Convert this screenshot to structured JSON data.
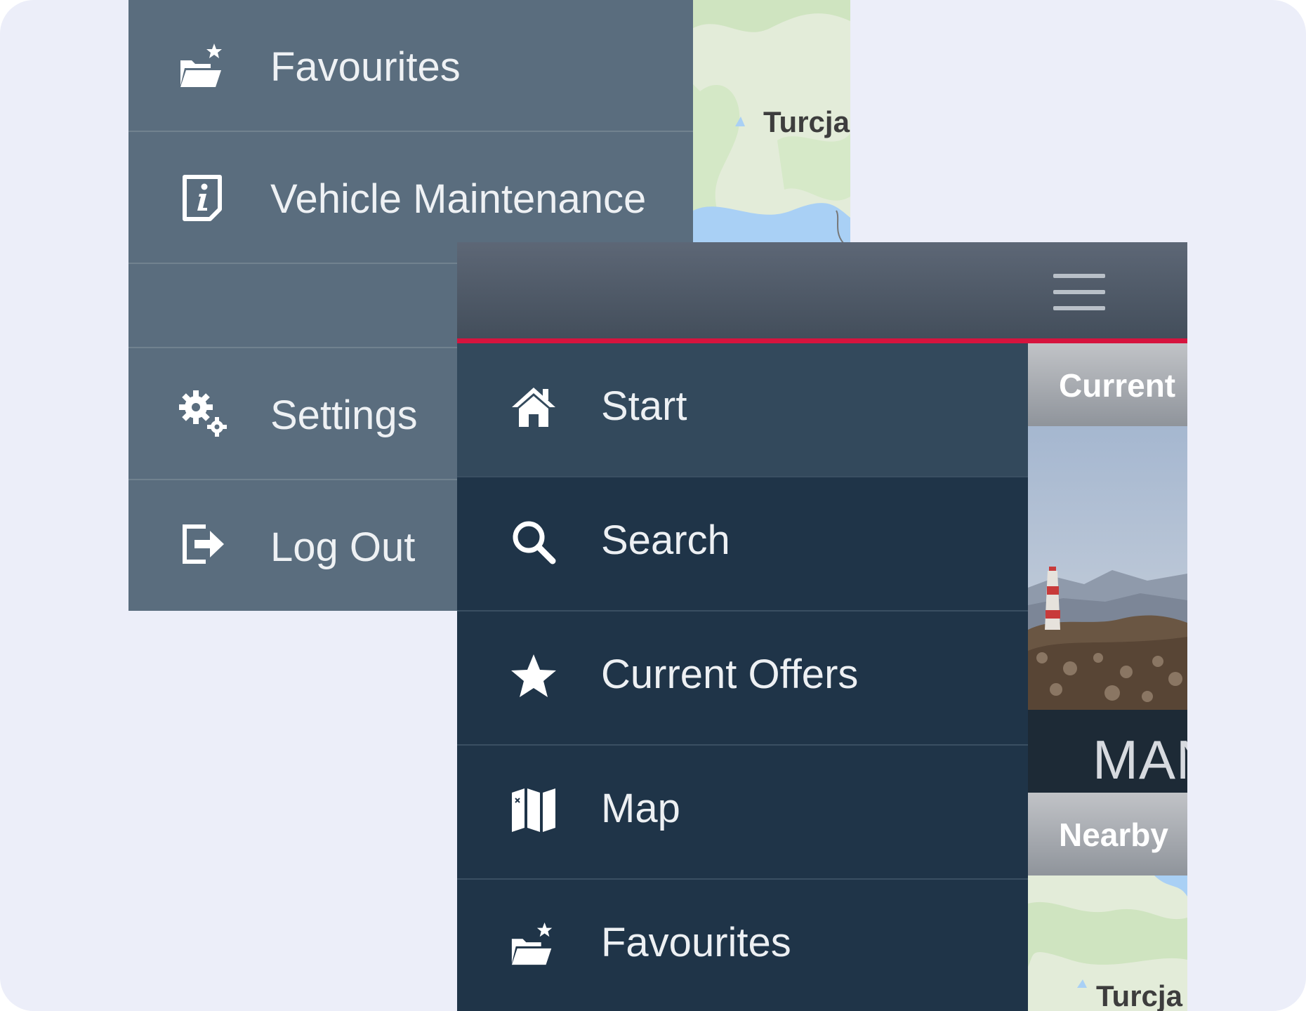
{
  "back_screen": {
    "menu": [
      {
        "label": "Favourites",
        "icon": "folder-star-icon"
      },
      {
        "label": "Vehicle  Maintenance",
        "icon": "info-document-icon"
      },
      {
        "label": "",
        "icon": ""
      },
      {
        "label": "Settings",
        "icon": "gears-icon"
      },
      {
        "label": "Log Out",
        "icon": "logout-icon"
      }
    ],
    "map_label": "Turcja"
  },
  "front_screen": {
    "header": {
      "menu_icon": "hamburger-icon",
      "accent_color": "#d6143e"
    },
    "menu": [
      {
        "label": "Start",
        "icon": "home-icon",
        "active": true
      },
      {
        "label": "Search",
        "icon": "search-icon",
        "active": false
      },
      {
        "label": "Current Offers",
        "icon": "star-icon",
        "active": false
      },
      {
        "label": "Map",
        "icon": "map-icon",
        "active": false
      },
      {
        "label": "Favourites",
        "icon": "folder-star-icon",
        "active": false
      }
    ],
    "content": {
      "current_label": "Current",
      "brand_text": "MAN",
      "nearby_label": "Nearby",
      "map_label": "Turcja"
    }
  },
  "colors": {
    "background": "#eceef9",
    "back_menu": "#5a6d7e",
    "front_menu": "#1f3448",
    "front_menu_active": "#33495c"
  }
}
